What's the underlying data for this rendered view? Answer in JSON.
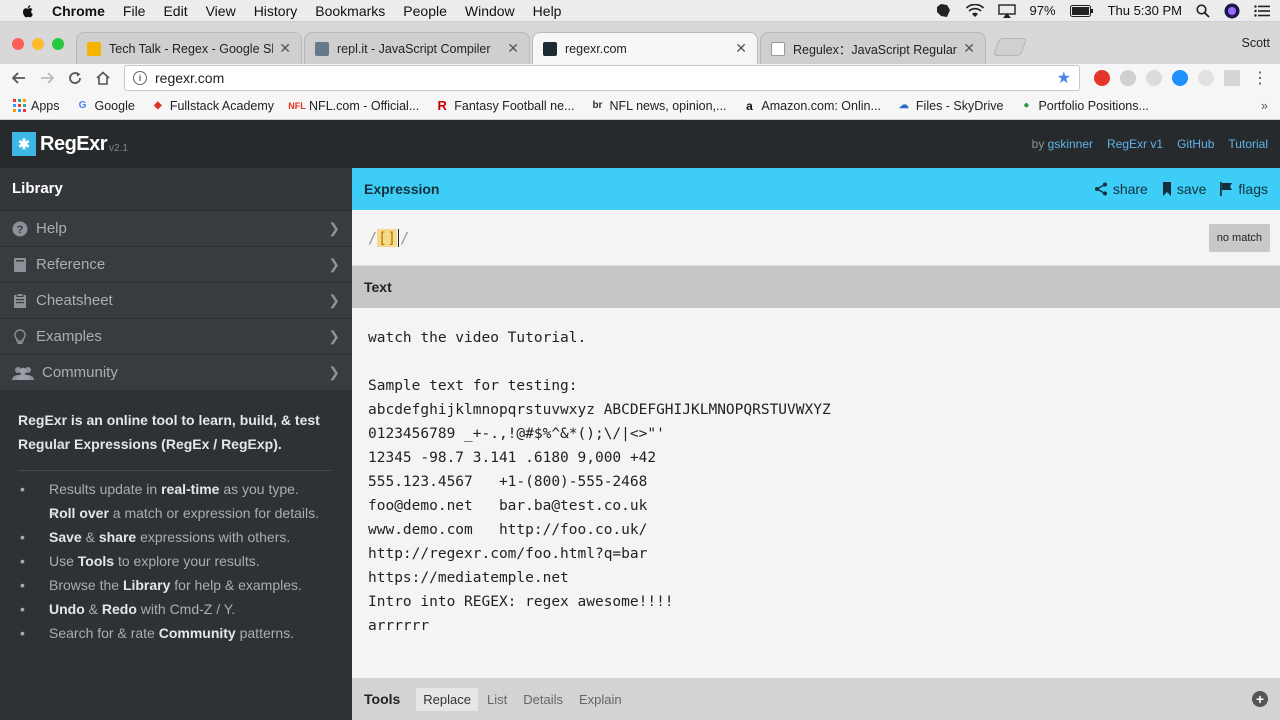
{
  "menubar": {
    "app": "Chrome",
    "items": [
      "File",
      "Edit",
      "View",
      "History",
      "Bookmarks",
      "People",
      "Window",
      "Help"
    ],
    "battery": "97%",
    "clock": "Thu 5:30 PM"
  },
  "tabs": [
    {
      "title": "Tech Talk - Regex - Google Sli",
      "favicon_color": "#f4b400",
      "active": false
    },
    {
      "title": "repl.it - JavaScript Compiler",
      "favicon_color": "#667a8a",
      "active": false
    },
    {
      "title": "regexr.com",
      "favicon_color": "#1e2a33",
      "active": true
    },
    {
      "title": "Regulex：JavaScript Regular E",
      "favicon_color": "#ffffff",
      "active": false
    }
  ],
  "profile": "Scott",
  "address": {
    "url": "regexr.com"
  },
  "bookmarks": [
    {
      "label": "Apps",
      "icon": "apps-grid-icon"
    },
    {
      "label": "Google",
      "icon": "google-icon"
    },
    {
      "label": "Fullstack Academy",
      "icon": "fullstack-icon"
    },
    {
      "label": "NFL.com - Official...",
      "icon": "nfl-icon"
    },
    {
      "label": "Fantasy Football ne...",
      "icon": "rotoworld-icon"
    },
    {
      "label": "NFL news, opinion,...",
      "icon": "bleacher-report-icon"
    },
    {
      "label": "Amazon.com: Onlin...",
      "icon": "amazon-icon"
    },
    {
      "label": "Files - SkyDrive",
      "icon": "skydrive-icon"
    },
    {
      "label": "Portfolio Positions...",
      "icon": "portfolio-icon"
    }
  ],
  "regexr": {
    "logo": "RegExr",
    "version": "v2.1",
    "header_links": {
      "by_prefix": "by",
      "by_name": "gskinner",
      "v1": "RegExr v1",
      "github": "GitHub",
      "tutorial": "Tutorial"
    },
    "sidebar": {
      "title": "Library",
      "items": [
        {
          "label": "Help",
          "icon": "help-icon"
        },
        {
          "label": "Reference",
          "icon": "book-icon"
        },
        {
          "label": "Cheatsheet",
          "icon": "clipboard-icon"
        },
        {
          "label": "Examples",
          "icon": "lightbulb-icon"
        },
        {
          "label": "Community",
          "icon": "people-icon"
        }
      ],
      "lead": "RegExr is an online tool to learn, build, & test Regular Expressions (RegEx / RegExp).",
      "bullets": [
        {
          "pre": "Results update in ",
          "bold": "real-time",
          "post": " as you type."
        },
        {
          "pre": "",
          "bold": "Roll over",
          "post": " a match or expression for details."
        },
        {
          "pre": "",
          "bold": "Save",
          "mid": " & ",
          "bold2": "share",
          "post": " expressions with others."
        },
        {
          "pre": "Use ",
          "bold": "Tools",
          "post": " to explore your results."
        },
        {
          "pre": "Browse the ",
          "bold": "Library",
          "post": " for help & examples."
        },
        {
          "pre": "",
          "bold": "Undo",
          "mid": " & ",
          "bold2": "Redo",
          "post": " with Cmd-Z / Y."
        },
        {
          "pre": "Search for & rate ",
          "bold": "Community",
          "post": " patterns."
        }
      ]
    },
    "expression": {
      "label": "Expression",
      "share": "share",
      "save": "save",
      "flags": "flags",
      "open_delim": "/",
      "pattern": "[]",
      "close_delim": "/",
      "status": "no match"
    },
    "text": {
      "label": "Text",
      "lines": [
        "watch the video Tutorial.",
        "",
        "Sample text for testing:",
        "abcdefghijklmnopqrstuvwxyz ABCDEFGHIJKLMNOPQRSTUVWXYZ",
        "0123456789 _+-.,!@#$%^&*();\\/|<>\"'",
        "12345 -98.7 3.141 .6180 9,000 +42",
        "555.123.4567   +1-(800)-555-2468",
        "foo@demo.net   bar.ba@test.co.uk",
        "www.demo.com   http://foo.co.uk/",
        "http://regexr.com/foo.html?q=bar",
        "https://mediatemple.net",
        "Intro into REGEX: regex awesome!!!!",
        "arrrrrr"
      ]
    },
    "tools": {
      "label": "Tools",
      "tabs": [
        "Replace",
        "List",
        "Details",
        "Explain"
      ],
      "active": "Replace"
    }
  }
}
